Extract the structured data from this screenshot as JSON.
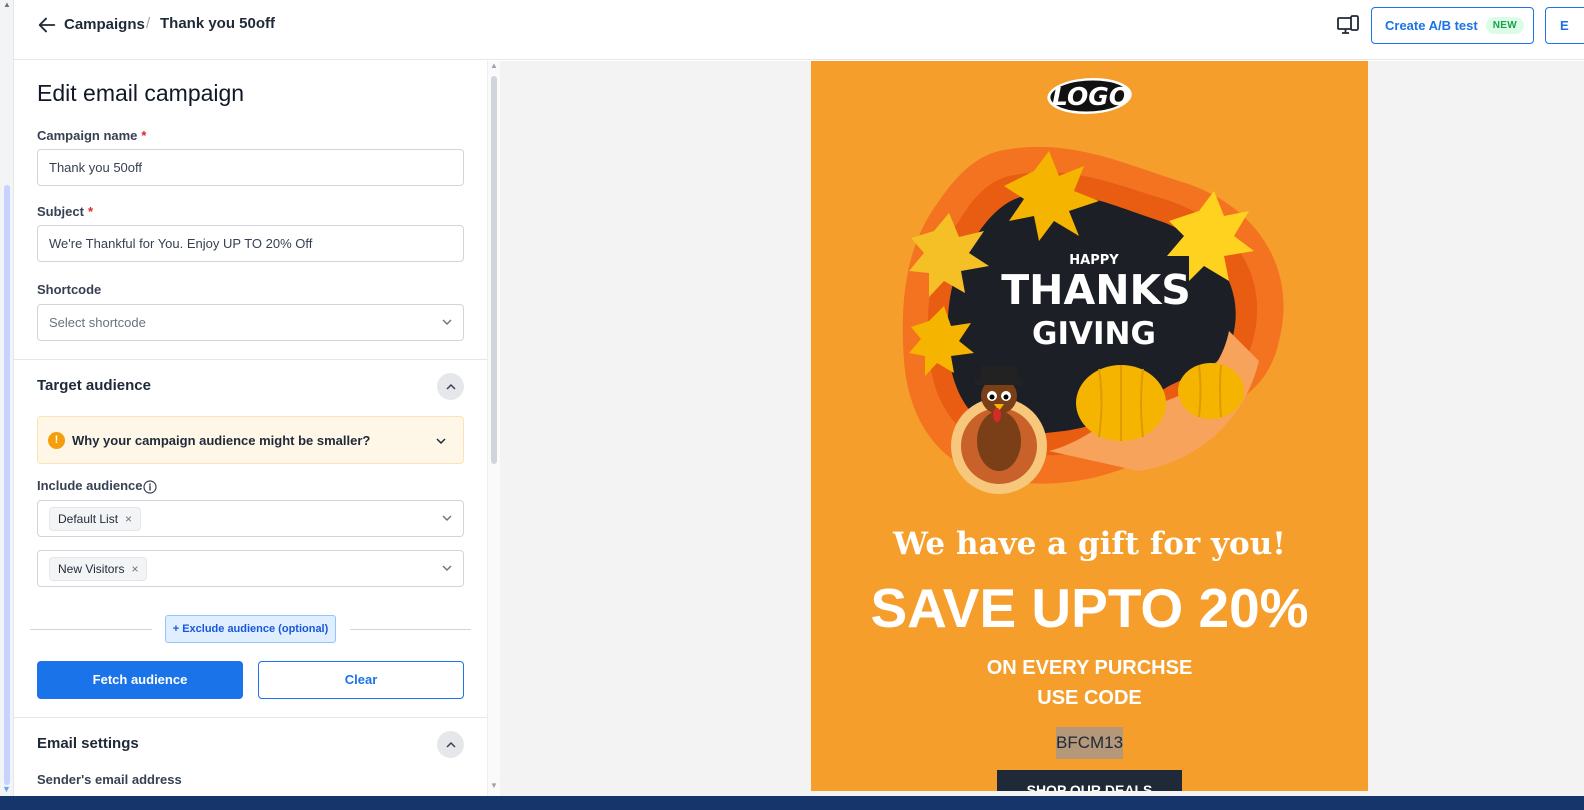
{
  "header": {
    "breadcrumb_root": "Campaigns",
    "breadcrumb_separator": "/",
    "breadcrumb_current": "Thank you 50off",
    "ab_test_label": "Create A/B test",
    "ab_test_badge": "NEW",
    "next_label": "E"
  },
  "panel": {
    "title": "Edit email campaign",
    "campaign_name_label": "Campaign name",
    "campaign_name_value": "Thank you 50off",
    "subject_label": "Subject",
    "subject_value": "We're Thankful for You. Enjoy UP TO 20% Off",
    "required_mark": "*",
    "shortcode_label": "Shortcode",
    "shortcode_placeholder": "Select shortcode",
    "target_audience_title": "Target audience",
    "warning_text": "Why your campaign audience might be smaller?",
    "warning_icon_glyph": "!",
    "include_audience_label": "Include audience",
    "audience_tag_1": "Default List",
    "audience_tag_2": "New Visitors",
    "tag_remove_glyph": "×",
    "exclude_audience_label": "+ Exclude audience (optional)",
    "fetch_label": "Fetch audience",
    "clear_label": "Clear",
    "email_settings_title": "Email settings",
    "sender_label": "Sender's email address"
  },
  "email_preview": {
    "logo_text": "LOGO",
    "hero_happy": "HAPPY",
    "hero_thanks": "THANKS",
    "hero_giving": "GIVING",
    "gift_text": "We have a gift for you!",
    "save_text": "SAVE UPTO 20%",
    "on_every_text": "ON EVERY PURCHSE",
    "use_code_text": "USE CODE",
    "code_value": "BFCM13",
    "shop_label": "SHOP OUR DEALS"
  },
  "colors": {
    "accent": "#1a73e8",
    "email_background": "#f59e2b",
    "warning_bg": "#fef6e7",
    "required": "#dc2626"
  }
}
